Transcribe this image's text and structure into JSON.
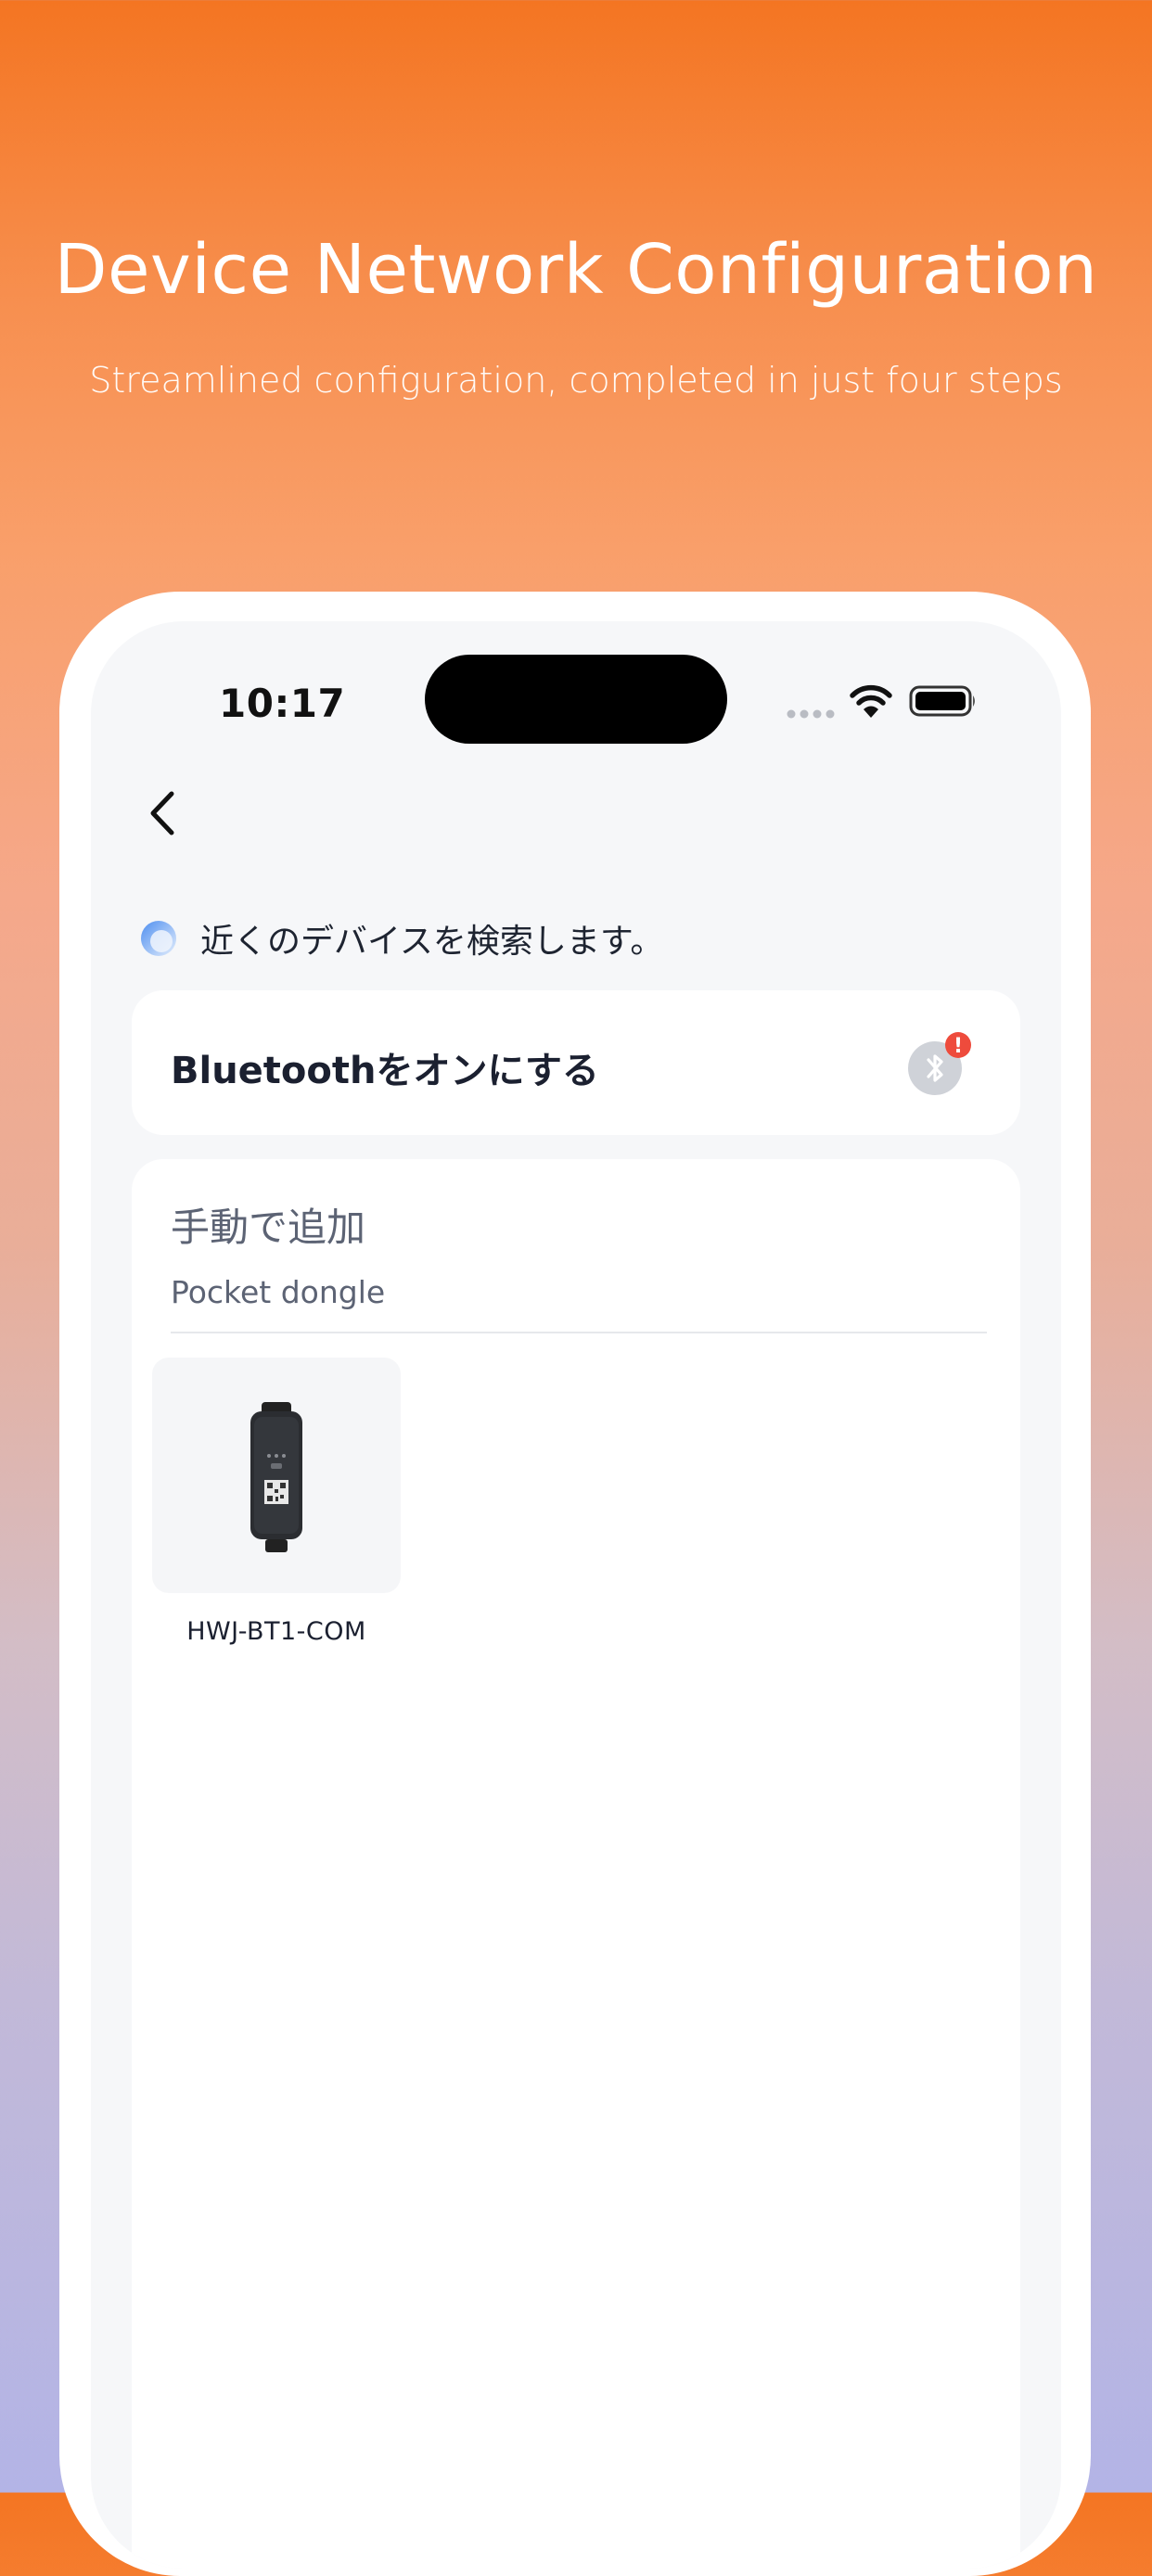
{
  "hero": {
    "title": "Device Network Configuration",
    "subtitle": "Streamlined configuration, completed in just four steps"
  },
  "status_bar": {
    "time": "10:17"
  },
  "nav": {
    "back_icon": "chevron-left-icon"
  },
  "search": {
    "status_text": "近くのデバイスを検索します。",
    "icon": "searching-spinner-icon"
  },
  "bluetooth_card": {
    "label": "Bluetoothをオンにする",
    "icon": "bluetooth-icon",
    "badge": "!",
    "badge_color": "#ee4b3c"
  },
  "manual_add": {
    "title": "手動で追加",
    "category": "Pocket dongle",
    "devices": [
      {
        "name": "HWJ-BT1-COM"
      }
    ]
  },
  "colors": {
    "accent_orange": "#f47522",
    "text_primary": "#1b2030",
    "text_secondary": "#5c6374"
  }
}
